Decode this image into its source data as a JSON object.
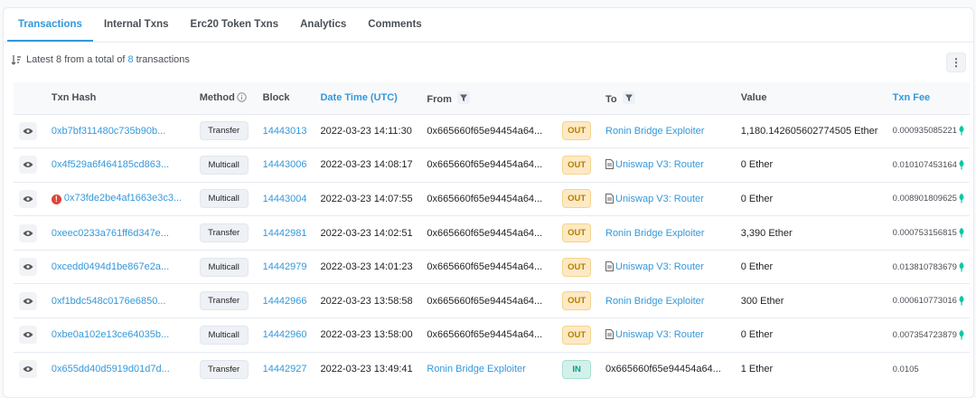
{
  "tabs": [
    {
      "label": "Transactions",
      "active": true
    },
    {
      "label": "Internal Txns",
      "active": false
    },
    {
      "label": "Erc20 Token Txns",
      "active": false
    },
    {
      "label": "Analytics",
      "active": false
    },
    {
      "label": "Comments",
      "active": false
    }
  ],
  "summary": {
    "prefix": "Latest 8 from a total of",
    "count": "8",
    "suffix": "transactions"
  },
  "more_button": {
    "label": "⋮"
  },
  "columns": {
    "txn_hash": "Txn Hash",
    "method": "Method",
    "block": "Block",
    "date_time": "Date Time (UTC)",
    "from": "From",
    "to": "To",
    "value": "Value",
    "txn_fee": "Txn Fee"
  },
  "rows": [
    {
      "hash": "0xb7bf311480c735b90b...",
      "error": false,
      "method": "Transfer",
      "block": "14443013",
      "datetime": "2022-03-23 14:11:30",
      "from": "0x665660f65e94454a64...",
      "from_link": false,
      "dir": "OUT",
      "to": "Ronin Bridge Exploiter",
      "to_link": true,
      "to_contract": false,
      "value": "1,180.142605602774505 Ether",
      "fee": "0.000935085221",
      "fee_icon": true
    },
    {
      "hash": "0x4f529a6f464185cd863...",
      "error": false,
      "method": "Multicall",
      "block": "14443006",
      "datetime": "2022-03-23 14:08:17",
      "from": "0x665660f65e94454a64...",
      "from_link": false,
      "dir": "OUT",
      "to": "Uniswap V3: Router",
      "to_link": true,
      "to_contract": true,
      "value": "0 Ether",
      "fee": "0.010107453164",
      "fee_icon": true
    },
    {
      "hash": "0x73fde2be4af1663e3c3...",
      "error": true,
      "method": "Multicall",
      "block": "14443004",
      "datetime": "2022-03-23 14:07:55",
      "from": "0x665660f65e94454a64...",
      "from_link": false,
      "dir": "OUT",
      "to": "Uniswap V3: Router",
      "to_link": true,
      "to_contract": true,
      "value": "0 Ether",
      "fee": "0.008901809625",
      "fee_icon": true
    },
    {
      "hash": "0xeec0233a761ff6d347e...",
      "error": false,
      "method": "Transfer",
      "block": "14442981",
      "datetime": "2022-03-23 14:02:51",
      "from": "0x665660f65e94454a64...",
      "from_link": false,
      "dir": "OUT",
      "to": "Ronin Bridge Exploiter",
      "to_link": true,
      "to_contract": false,
      "value": "3,390 Ether",
      "fee": "0.000753156815",
      "fee_icon": true
    },
    {
      "hash": "0xcedd0494d1be867e2a...",
      "error": false,
      "method": "Multicall",
      "block": "14442979",
      "datetime": "2022-03-23 14:01:23",
      "from": "0x665660f65e94454a64...",
      "from_link": false,
      "dir": "OUT",
      "to": "Uniswap V3: Router",
      "to_link": true,
      "to_contract": true,
      "value": "0 Ether",
      "fee": "0.013810783679",
      "fee_icon": true
    },
    {
      "hash": "0xf1bdc548c0176e6850...",
      "error": false,
      "method": "Transfer",
      "block": "14442966",
      "datetime": "2022-03-23 13:58:58",
      "from": "0x665660f65e94454a64...",
      "from_link": false,
      "dir": "OUT",
      "to": "Ronin Bridge Exploiter",
      "to_link": true,
      "to_contract": false,
      "value": "300 Ether",
      "fee": "0.000610773016",
      "fee_icon": true
    },
    {
      "hash": "0xbe0a102e13ce64035b...",
      "error": false,
      "method": "Multicall",
      "block": "14442960",
      "datetime": "2022-03-23 13:58:00",
      "from": "0x665660f65e94454a64...",
      "from_link": false,
      "dir": "OUT",
      "to": "Uniswap V3: Router",
      "to_link": true,
      "to_contract": true,
      "value": "0 Ether",
      "fee": "0.007354723879",
      "fee_icon": true
    },
    {
      "hash": "0x655dd40d5919d01d7d...",
      "error": false,
      "method": "Transfer",
      "block": "14442927",
      "datetime": "2022-03-23 13:49:41",
      "from": "Ronin Bridge Exploiter",
      "from_link": true,
      "dir": "IN",
      "to": "0x665660f65e94454a64...",
      "to_link": false,
      "to_contract": false,
      "value": "1 Ether",
      "fee": "0.0105",
      "fee_icon": false
    }
  ],
  "colors": {
    "accent": "#3498db",
    "out": "#b47d00",
    "in": "#00a186",
    "error": "#de4437",
    "fee_icon": "#00c9a7"
  }
}
